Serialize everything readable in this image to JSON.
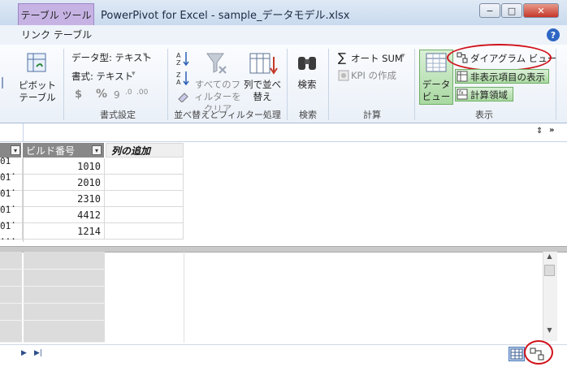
{
  "window": {
    "context_tab": "テーブル ツール",
    "title": "PowerPivot for Excel - sample_データモデル.xlsx",
    "minimize_label": "−",
    "restore_label": "□",
    "close_label": "✕"
  },
  "ribbon_tabs": {
    "active": "リンク テーブル",
    "help": "?"
  },
  "ribbon": {
    "pivot_table": "ピボット テーブル",
    "format_group": {
      "data_type": "データ型: テキスト",
      "format": "書式: テキスト",
      "dollar": "$",
      "percent": "%",
      "comma": "9",
      "label": "書式設定"
    },
    "sort_group": {
      "clear_filters": "すべてのフィルターをクリア",
      "sort_by_column": "列で並べ替え",
      "label": "並べ替えとフィルター処理"
    },
    "search_group": {
      "find": "検索",
      "label": "検索"
    },
    "calc_group": {
      "autosum": "オート SUM",
      "kpi": "KPI の作成",
      "label": "計算"
    },
    "view_group": {
      "data_view": "データ ビュー",
      "diagram_view": "ダイアグラム ビュー",
      "show_hidden": "非表示項目の表示",
      "calc_area": "計算領域",
      "label": "表示"
    }
  },
  "grid": {
    "columns": [
      "ビルド番号",
      "列の追加"
    ],
    "rows": [
      {
        "left": "01 ...",
        "build": "1010"
      },
      {
        "left": "01 ...",
        "build": "2010"
      },
      {
        "left": "01 ...",
        "build": "2310"
      },
      {
        "left": "01 ...",
        "build": "4412"
      },
      {
        "left": "01 ...",
        "build": "1214"
      }
    ]
  },
  "status": {
    "nav_next": "▶",
    "nav_last": "▶|"
  }
}
